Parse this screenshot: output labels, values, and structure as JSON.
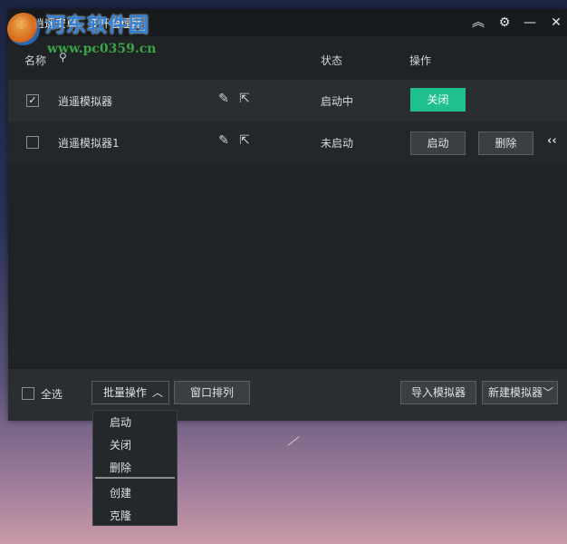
{
  "window": {
    "title": "逍遥安卓 - 多开管理器",
    "controls": [
      "collapse-up-icon",
      "gear-icon",
      "minimize-icon",
      "close-icon"
    ]
  },
  "watermark": {
    "title": "河东软件园",
    "url": "www.pc0359.cn"
  },
  "table": {
    "headers": {
      "name": "名称",
      "status": "状态",
      "actions": "操作"
    },
    "rows": [
      {
        "checked": true,
        "name": "逍遥模拟器",
        "status": "启动中",
        "actions": [
          "关闭"
        ]
      },
      {
        "checked": false,
        "name": "逍遥模拟器1",
        "status": "未启动",
        "actions": [
          "启动",
          "删除"
        ]
      }
    ]
  },
  "bottom": {
    "select_all": "全选",
    "batch": "批量操作",
    "arrange": "窗口排列",
    "import": "导入模拟器",
    "create": "新建模拟器"
  },
  "dropdown": {
    "items": [
      "启动",
      "关闭",
      "删除",
      "创建",
      "克隆"
    ]
  },
  "colors": {
    "accent": "#1fbf8f",
    "window_bg": "#1f2326"
  }
}
